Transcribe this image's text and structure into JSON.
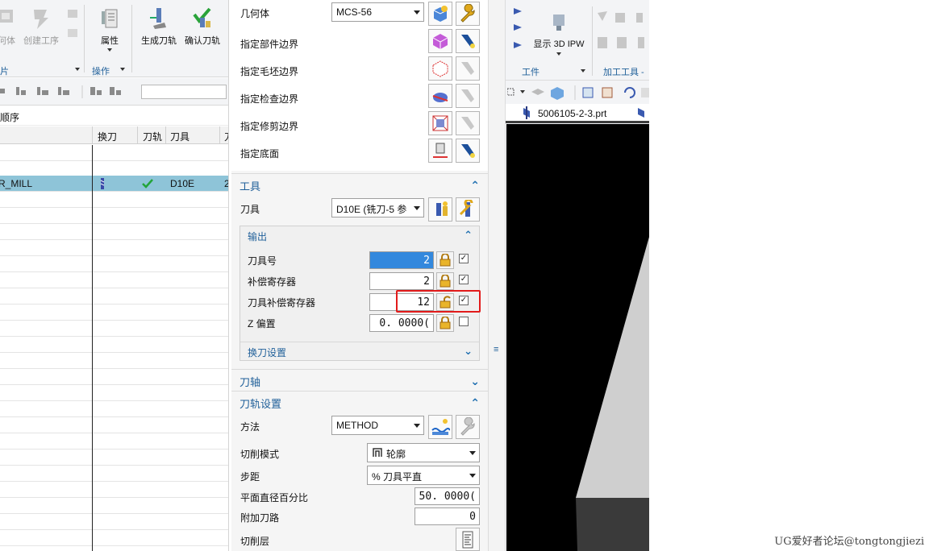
{
  "left_panel": {
    "ribbon": {
      "btn_geometry_partial": "何体",
      "btn_create_op": "创建工序",
      "btn_properties": "属性",
      "btn_generate": "生成刀轨",
      "btn_verify": "确认刀轨",
      "group_insert_partial": "片",
      "group_operation": "操作"
    },
    "navigator_title_partial": "顺序",
    "columns": [
      "换刀",
      "刀轨",
      "刀具",
      "刀"
    ],
    "selected_row": {
      "name_partial": "R_MILL",
      "tool": "D10E",
      "col4_partial": "2"
    }
  },
  "dialog": {
    "geometry_label": "几何体",
    "geometry_value": "MCS-56",
    "specify_rows": [
      "指定部件边界",
      "指定毛坯边界",
      "指定检查边界",
      "指定修剪边界",
      "指定底面"
    ],
    "tool_section": {
      "title": "工具",
      "tool_label": "刀具",
      "tool_value": "D10E (铣刀-5 参",
      "output": {
        "title": "输出",
        "fields": [
          {
            "label": "刀具号",
            "value": "2",
            "locked": true,
            "checked": true,
            "highlighted": true
          },
          {
            "label": "补偿寄存器",
            "value": "2",
            "locked": true,
            "checked": true,
            "highlighted": false
          },
          {
            "label": "刀具补偿寄存器",
            "value": "12",
            "locked": false,
            "checked": true,
            "highlighted": false
          },
          {
            "label": "Z 偏置",
            "value": "0. 0000(",
            "locked": true,
            "checked": false,
            "highlighted": false
          }
        ]
      },
      "toolchange_title": "换刀设置"
    },
    "axis_section": {
      "title": "刀轴"
    },
    "path_section": {
      "title": "刀轨设置",
      "method_label": "方法",
      "method_value": "METHOD",
      "cut_mode_label": "切削模式",
      "cut_mode_value": "轮廓",
      "stepover_label": "步距",
      "stepover_value": "% 刀具平直",
      "percent_label": "平面直径百分比",
      "percent_value": "50. 0000(",
      "extra_label": "附加刀路",
      "extra_value": "0",
      "levels_label": "切削层"
    }
  },
  "right_panel": {
    "ribbon": {
      "show_ipw": "显示 3D IPW",
      "group_workpiece": "工件",
      "group_machining_partial": "加工工具 -"
    },
    "file_tab": "5006105-2-3.prt"
  },
  "watermark": "UG爱好者论坛@tongtongjiezi",
  "colors": {
    "accent_blue": "#1f5f99",
    "selection_row": "#8ec4d8",
    "highlight_field": "#3388dd",
    "annotation_red": "#e21b1b",
    "viewport_bg": "#000000",
    "model_grey": "#cfcfcf"
  }
}
